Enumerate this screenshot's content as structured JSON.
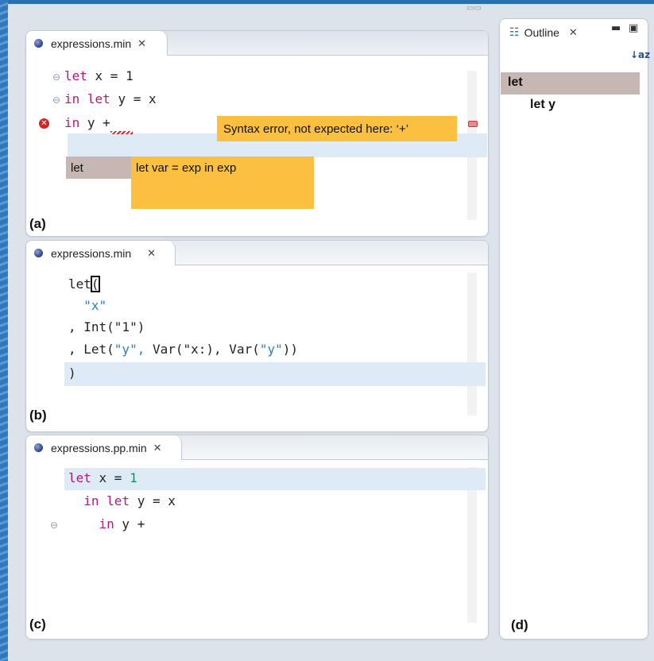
{
  "editor_a": {
    "tab_label": "expressions.min",
    "code_lines": [
      "let x = 1",
      "in let y = x",
      "in y +"
    ],
    "error_tooltip": "Syntax error, not expected here: ‘+’",
    "completion_item": "let",
    "completion_proposal": "let var = exp in exp",
    "panel_label": "(a)"
  },
  "editor_b": {
    "tab_label": "expressions.min",
    "panel_label": "(b)"
  },
  "editor_c": {
    "tab_label": "expressions.pp.min",
    "panel_label": "(c)"
  },
  "outline": {
    "tab_label": "Outline",
    "items": [
      "let",
      "let y"
    ],
    "panel_label": "(d)"
  },
  "colors": {
    "keyword": "#c0137e",
    "string": "#2a7fb5",
    "tooltip": "#fbc040",
    "selection": "#c6b7b3",
    "current_line": "#dfeaf7",
    "error": "#d02525"
  },
  "icons": [
    "file-icon",
    "close-icon",
    "fold-icon",
    "error-icon",
    "outline-icon",
    "sort-icon",
    "minimize-icon",
    "maximize-icon"
  ]
}
